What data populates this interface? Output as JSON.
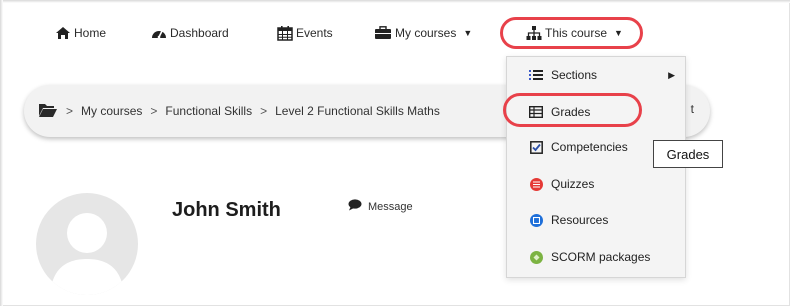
{
  "navbar": {
    "items": [
      {
        "label": "Home",
        "icon": "home-icon"
      },
      {
        "label": "Dashboard",
        "icon": "dashboard-icon"
      },
      {
        "label": "Events",
        "icon": "calendar-icon"
      },
      {
        "label": "My courses",
        "icon": "briefcase-icon",
        "has_dropdown": true
      },
      {
        "label": "This course",
        "icon": "sitemap-icon",
        "has_dropdown": true
      }
    ]
  },
  "breadcrumb": {
    "icon": "folder-open-icon",
    "items": [
      "My courses",
      "Functional Skills",
      "Level 2 Functional Skills Maths"
    ],
    "tail": "t"
  },
  "dropdown": {
    "items": [
      {
        "label": "Sections",
        "icon": "list-icon",
        "submenu": true
      },
      {
        "label": "Grades",
        "icon": "table-icon"
      },
      {
        "label": "Competencies",
        "icon": "checkbox-icon"
      },
      {
        "label": "Quizzes",
        "icon": "quiz-icon",
        "color": "#e53935"
      },
      {
        "label": "Resources",
        "icon": "resource-icon",
        "color": "#1e6fd9"
      },
      {
        "label": "SCORM packages",
        "icon": "scorm-icon",
        "color": "#7cb342"
      }
    ]
  },
  "tooltip": {
    "text": "Grades"
  },
  "profile": {
    "name": "John Smith",
    "message_label": "Message"
  },
  "colors": {
    "highlight": "#e8414a"
  }
}
